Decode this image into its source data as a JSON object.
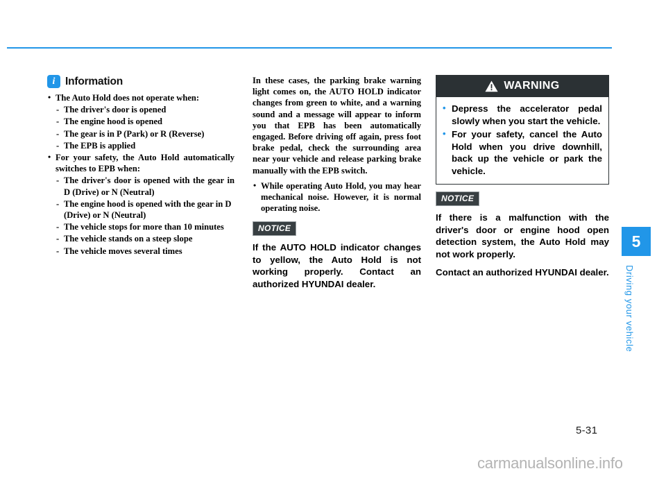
{
  "page": {
    "number": "5-31",
    "watermark": "carmanualsonline.info",
    "accent_color": "#2196e8",
    "dark_color": "#2b3134"
  },
  "side_tab": {
    "chapter_number": "5",
    "chapter_label": "Driving your vehicle"
  },
  "information": {
    "icon": "info-icon",
    "title": "Information",
    "items": [
      {
        "level": 1,
        "text": "The Auto Hold does not operate when:"
      },
      {
        "level": 2,
        "text": "The driver's door is opened"
      },
      {
        "level": 2,
        "text": "The engine hood is opened"
      },
      {
        "level": 2,
        "text": "The gear is in P (Park) or R (Reverse)"
      },
      {
        "level": 2,
        "text": "The EPB is applied"
      },
      {
        "level": 1,
        "text": "For your safety, the Auto Hold automatically switches to EPB when:"
      },
      {
        "level": 2,
        "text": "The driver's door is opened with the gear in D (Drive) or N (Neutral)"
      },
      {
        "level": 2,
        "text": "The engine hood is opened with the gear in D (Drive) or N (Neutral)"
      },
      {
        "level": 2,
        "text": "The vehicle stops for more than 10 minutes"
      },
      {
        "level": 2,
        "text": "The vehicle stands on a steep slope"
      },
      {
        "level": 2,
        "text": "The vehicle moves several times"
      }
    ]
  },
  "middle_column": {
    "paragraph": "In these cases, the parking brake warning light comes on, the AUTO HOLD indicator changes from green to white, and a warning sound and a message will appear to inform you that EPB has been automatically engaged. Before driving off again, press foot brake pedal, check the surrounding area near your vehicle and release parking brake manually with the EPB switch.",
    "bullet": "While operating Auto Hold, you may hear mechanical noise. However, it is normal operating noise.",
    "notice_label": "NOTICE",
    "notice_text": "If the AUTO HOLD indicator changes to yellow, the Auto Hold is not working properly. Contact an authorized HYUNDAI dealer."
  },
  "warning_box": {
    "icon": "warning-triangle-icon",
    "heading": "WARNING",
    "items": [
      "Depress the accelerator pedal slowly when you start the vehicle.",
      "For your safety, cancel the Auto Hold when you drive downhill, back up the vehicle or park the vehicle."
    ]
  },
  "right_notice": {
    "label": "NOTICE",
    "paragraphs": [
      "If there is a malfunction with the driver's door or engine hood open detection system, the Auto Hold may not work properly.",
      "Contact an authorized HYUNDAI dealer."
    ]
  }
}
